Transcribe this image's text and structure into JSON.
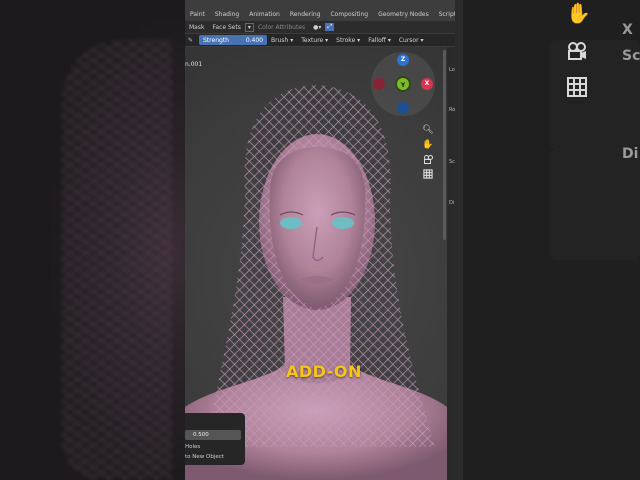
{
  "header": {
    "tabs": [
      "Paint",
      "Shading",
      "Animation",
      "Rendering",
      "Compositing",
      "Geometry Nodes",
      "Scripting",
      "+"
    ]
  },
  "toolbar": {
    "mask_label": "Mask",
    "face_sets_label": "Face Sets",
    "color_attributes_label": "Color Attributes"
  },
  "tool_settings": {
    "strength_label": "Strength",
    "strength_value": "0.400",
    "brush_label": "Brush",
    "texture_label": "Texture",
    "stroke_label": "Stroke",
    "falloff_label": "Falloff",
    "cursor_label": "Cursor"
  },
  "viewport": {
    "object_name": "n.001"
  },
  "gizmo": {
    "z_label": "Z",
    "x_label": "X",
    "y_label": "Y"
  },
  "operator_panel": {
    "value": "0.500",
    "line1": "Holes",
    "line2": "to New Object"
  },
  "side_panel": {
    "labels": [
      "Lo",
      "Ro",
      "Sc",
      "Di"
    ]
  },
  "right_ghost": {
    "letters": [
      "X",
      "Sc",
      "Di"
    ]
  },
  "overlay": {
    "caption": "ADD-ON"
  },
  "colors": {
    "accent_blue": "#4772b3",
    "caption_yellow": "#f5c518",
    "skin": "#b88aa4",
    "axis_x": "#d9334f",
    "axis_y": "#7dbb2d",
    "axis_z": "#2c73d2"
  }
}
